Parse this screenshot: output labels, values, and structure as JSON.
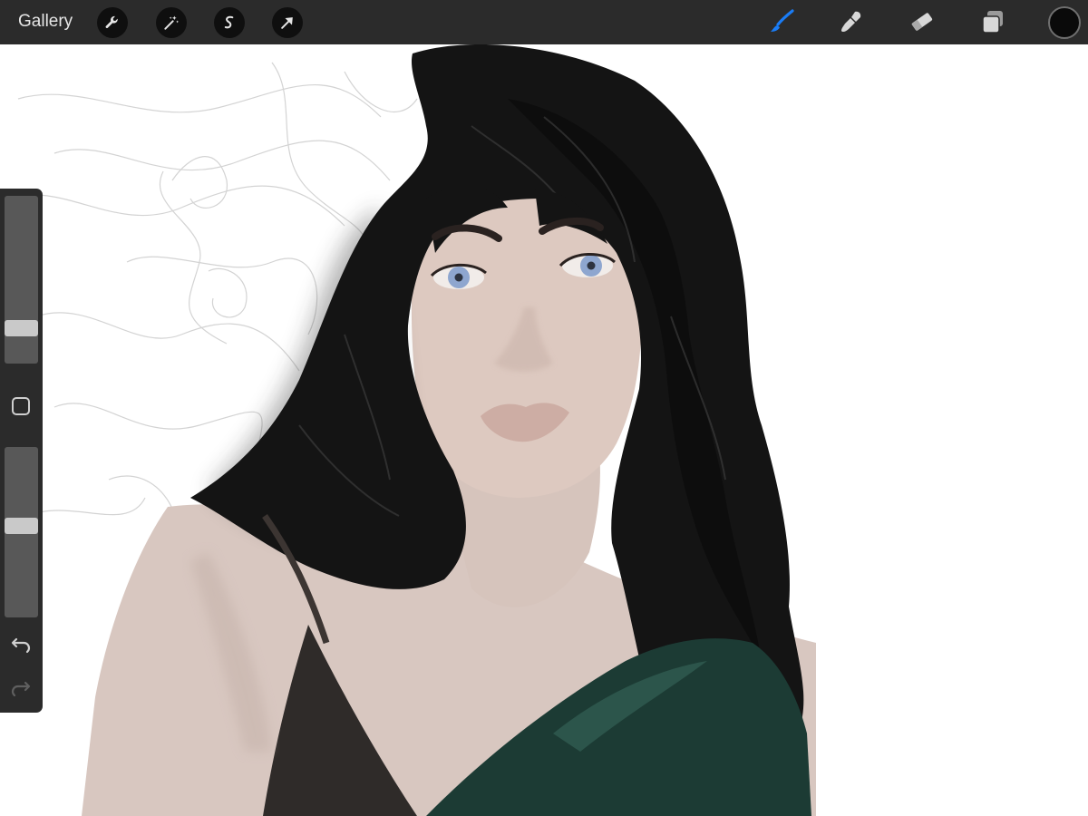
{
  "toolbar": {
    "gallery_label": "Gallery",
    "left_tools": [
      {
        "name": "actions-wrench-icon"
      },
      {
        "name": "adjustments-magic-wand-icon"
      },
      {
        "name": "selection-icon"
      },
      {
        "name": "transform-arrow-icon"
      }
    ],
    "right_tools": [
      {
        "name": "brush-icon",
        "active": true
      },
      {
        "name": "smudge-icon",
        "active": false
      },
      {
        "name": "eraser-icon",
        "active": false
      },
      {
        "name": "layers-icon",
        "active": false
      }
    ],
    "active_color": "#0a0a0a",
    "accent_color": "#1a7cf5"
  },
  "sidebar": {
    "brush_size": 0.18,
    "opacity": 0.54,
    "modify_button": "square-icon",
    "undo": "undo-arrow-icon",
    "redo": "redo-arrow-icon"
  },
  "canvas": {
    "colors": {
      "hair": "#121212",
      "skin": "#ddc9c0",
      "eyes": "#8ea6cf",
      "top": "#2f2b29",
      "shawl": "#1c3b34",
      "sketch": "#b0b0b0"
    }
  }
}
